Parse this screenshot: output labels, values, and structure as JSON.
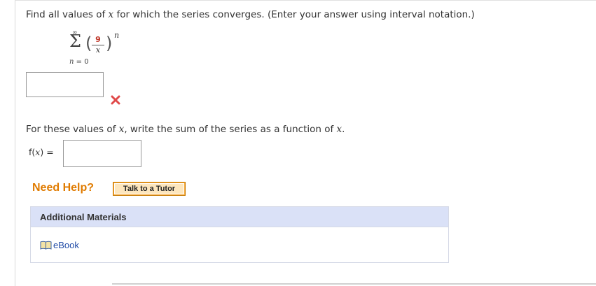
{
  "question": {
    "text_before_var": "Find all values of ",
    "variable": "x",
    "text_after_var": " for which the series converges. (Enter your answer using interval notation.)"
  },
  "series": {
    "sigma": "Σ",
    "upper": "∞",
    "lower_var": "n",
    "lower_rest": " = 0",
    "numerator": "9",
    "denominator": "x",
    "exponent": "n",
    "paren_left": "(",
    "paren_right": ")"
  },
  "answer1": {
    "value": ""
  },
  "status": {
    "icon": "x-mark-icon",
    "color": "#e04a4a"
  },
  "prompt2": {
    "text1": "For these values of ",
    "var1": "x",
    "text2": ", write the sum of the series as a function of ",
    "var2": "x",
    "text3": "."
  },
  "fx": {
    "label_pre": "f(",
    "label_var": "x",
    "label_post": ") =",
    "value": ""
  },
  "help": {
    "need_help": "Need Help?",
    "tutor_button": "Talk to a Tutor"
  },
  "materials": {
    "title": "Additional Materials",
    "ebook_label": "eBook",
    "ebook_icon": "book-icon"
  }
}
